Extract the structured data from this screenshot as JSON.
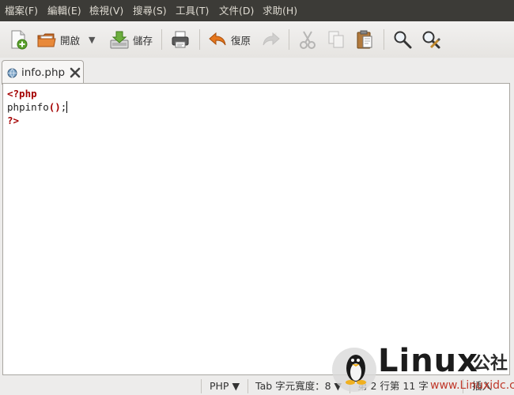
{
  "menubar": {
    "items": [
      "檔案(F)",
      "編輯(E)",
      "檢視(V)",
      "搜尋(S)",
      "工具(T)",
      "文件(D)",
      "求助(H)"
    ]
  },
  "toolbar": {
    "open_label": "開啟",
    "save_label": "儲存",
    "revert_label": "復原"
  },
  "tab": {
    "filename": "info.php"
  },
  "editor": {
    "lines": [
      "<?php",
      "phpinfo();",
      "?>"
    ]
  },
  "statusbar": {
    "language": "PHP ▼",
    "tab_width": "Tab 字元寬度：8 ▼",
    "position": "第 2 行第 11 字",
    "mode": "插入"
  },
  "watermark": {
    "logo_text": "Linux",
    "logo_cn": "公社",
    "url": "www.Linuxidc.com"
  }
}
